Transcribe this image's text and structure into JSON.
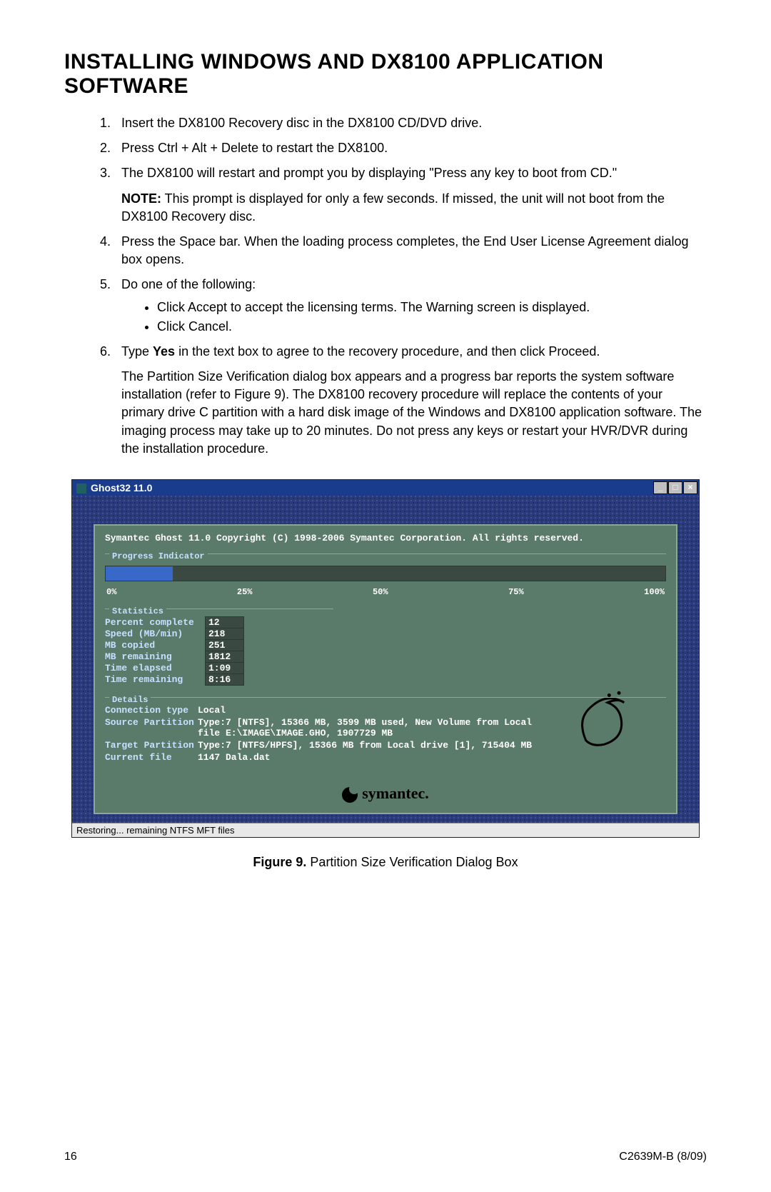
{
  "title": "INSTALLING WINDOWS AND DX8100 APPLICATION SOFTWARE",
  "steps": {
    "s1": "Insert the DX8100 Recovery disc in the DX8100 CD/DVD drive.",
    "s2": "Press Ctrl + Alt + Delete to restart the DX8100.",
    "s3": "The DX8100 will restart and prompt you by displaying \"Press any key to boot from CD.\"",
    "s3_note_label": "NOTE:",
    "s3_note": " This prompt is displayed for only a few seconds. If missed, the unit will not boot from the DX8100 Recovery disc.",
    "s4": "Press the Space bar. When the loading process completes, the End User License Agreement dialog box opens.",
    "s5": "Do one of the following:",
    "s5a": "Click Accept to accept the licensing terms. The Warning screen is displayed.",
    "s5b": "Click Cancel.",
    "s6_pre": "Type ",
    "s6_yes": "Yes",
    "s6_post": " in the text box to agree to the recovery procedure, and then click Proceed.",
    "s6_para": "The Partition Size Verification dialog box appears and a progress bar reports the system software installation (refer to Figure 9). The DX8100 recovery procedure will replace the contents of your primary drive C partition with a hard disk image of the Windows and DX8100 application software. The imaging process may take up to 20 minutes. Do not press any keys or restart your HVR/DVR during the installation procedure."
  },
  "ghost": {
    "window_title": "Ghost32 11.0",
    "copyright": "Symantec Ghost 11.0   Copyright (C) 1998-2006 Symantec Corporation. All rights reserved.",
    "progress_label": "Progress Indicator",
    "ticks": [
      "0%",
      "25%",
      "50%",
      "75%",
      "100%"
    ],
    "stats_label": "Statistics",
    "stats": [
      {
        "label": "Percent complete",
        "val": "12"
      },
      {
        "label": "Speed (MB/min)",
        "val": "218"
      },
      {
        "label": "MB copied",
        "val": "251"
      },
      {
        "label": "MB remaining",
        "val": "1812"
      },
      {
        "label": "Time elapsed",
        "val": "1:09"
      },
      {
        "label": "Time remaining",
        "val": "8:16"
      }
    ],
    "details_label": "Details",
    "details": {
      "conn_type_l": "Connection type",
      "conn_type_v": "Local",
      "src_part_l": "Source Partition",
      "src_part_v": "Type:7 [NTFS], 15366 MB, 3599 MB used, New Volume from Local file E:\\IMAGE\\IMAGE.GHO, 1907729 MB",
      "tgt_part_l": "Target Partition",
      "tgt_part_v": "Type:7 [NTFS/HPFS], 15366 MB from Local drive [1], 715404 MB",
      "cur_file_l": "Current file",
      "cur_file_v": "1147 Dala.dat"
    },
    "symantec": "symantec.",
    "status": "Restoring... remaining NTFS MFT files"
  },
  "figure_label": "Figure 9.",
  "figure_caption": " Partition Size Verification Dialog Box",
  "footer_left": "16",
  "footer_right": "C2639M-B (8/09)"
}
